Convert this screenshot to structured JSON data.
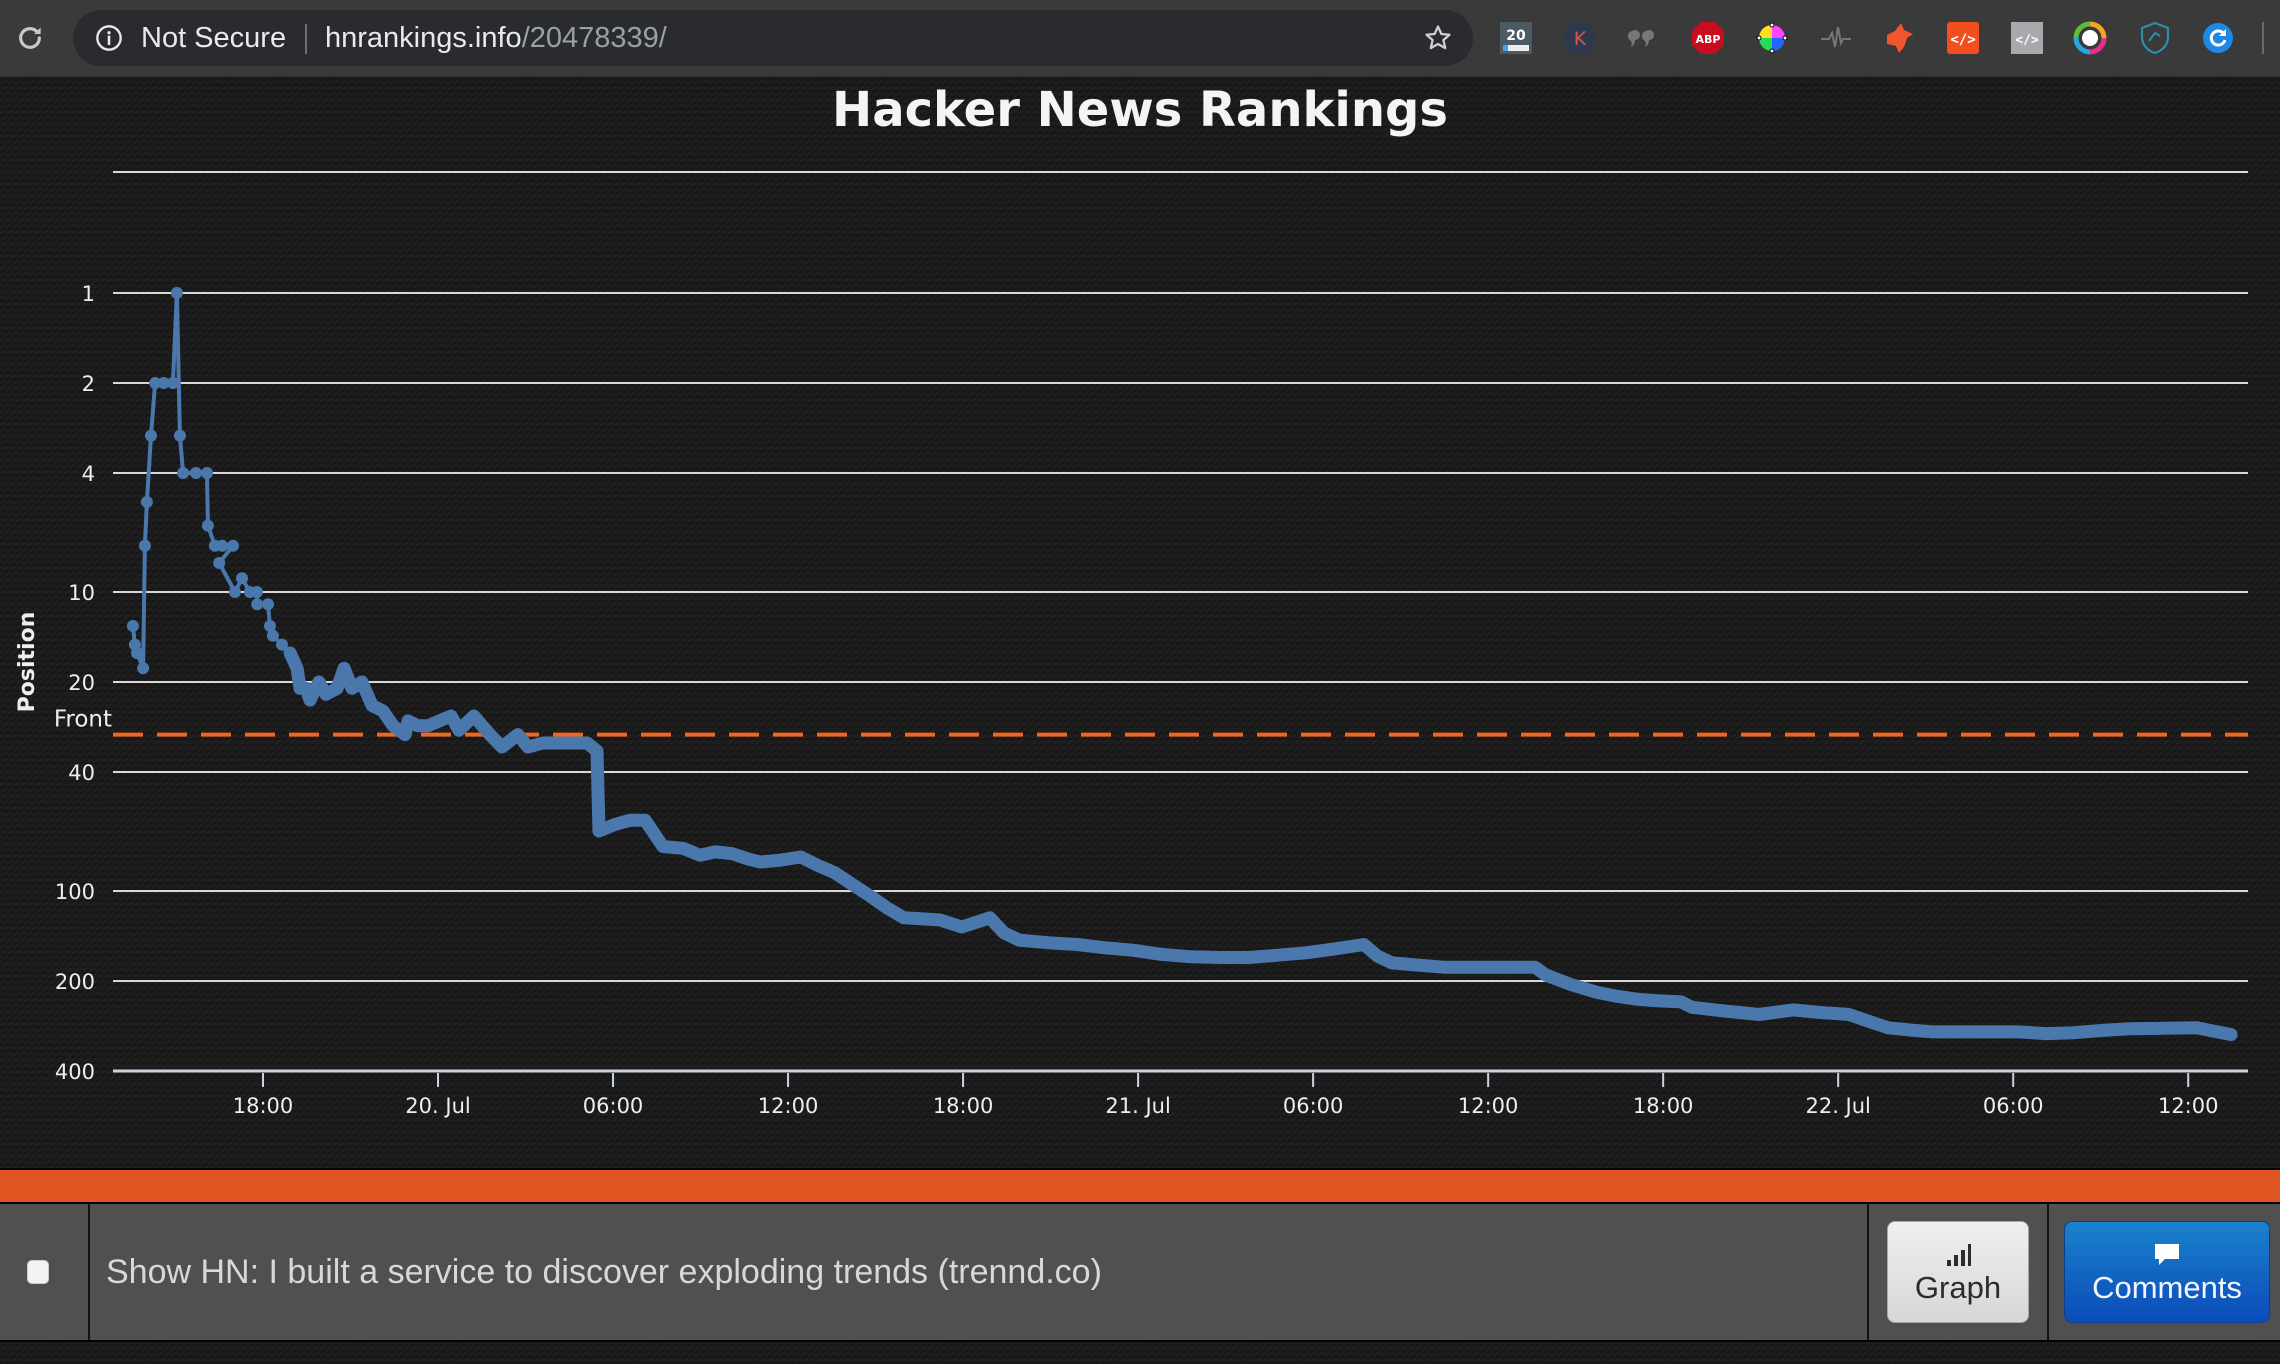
{
  "browser": {
    "security_label": "Not Secure",
    "url_host": "hnrankings.info",
    "url_path": "/20478339/",
    "extensions": [
      {
        "name": "tab-counter-extension-icon",
        "badge": "20"
      },
      {
        "name": "k-extension-icon",
        "badge": "K"
      },
      {
        "name": "quotes-extension-icon",
        "badge": ""
      },
      {
        "name": "adblock-plus-extension-icon",
        "badge": "ABP"
      },
      {
        "name": "color-picker-extension-icon",
        "badge": ""
      },
      {
        "name": "pulse-extension-icon",
        "badge": ""
      },
      {
        "name": "fox-extension-icon",
        "badge": ""
      },
      {
        "name": "code-red-extension-icon",
        "badge": ""
      },
      {
        "name": "code-gray-extension-icon",
        "badge": ""
      },
      {
        "name": "color-ring-extension-icon",
        "badge": ""
      },
      {
        "name": "shield-extension-icon",
        "badge": ""
      },
      {
        "name": "refresh-blue-extension-icon",
        "badge": ""
      }
    ]
  },
  "chart_data": {
    "type": "line",
    "title": "Hacker News Rankings",
    "xlabel": "",
    "ylabel": "Position",
    "y_scale": "log2-reversed",
    "ylim": [
      1,
      400
    ],
    "y_ticks": [
      1,
      2,
      4,
      10,
      20,
      40,
      100,
      200,
      400
    ],
    "x_unit": "hours since 19 Jul 00:00",
    "xlim": [
      13.0,
      87.0
    ],
    "x_ticks": [
      {
        "t": 18,
        "label": "18:00"
      },
      {
        "t": 24,
        "label": "20. Jul"
      },
      {
        "t": 30,
        "label": "06:00"
      },
      {
        "t": 36,
        "label": "12:00"
      },
      {
        "t": 42,
        "label": "18:00"
      },
      {
        "t": 48,
        "label": "21. Jul"
      },
      {
        "t": 54,
        "label": "06:00"
      },
      {
        "t": 60,
        "label": "12:00"
      },
      {
        "t": 66,
        "label": "18:00"
      },
      {
        "t": 72,
        "label": "22. Jul"
      },
      {
        "t": 78,
        "label": "06:00"
      },
      {
        "t": 84,
        "label": "12:00"
      }
    ],
    "grid": true,
    "reference_line": {
      "label": "Front",
      "value": 30,
      "color": "#f26522"
    },
    "series": [
      {
        "name": "Position",
        "color": "#4a78ad",
        "points": [
          [
            13.54,
            13
          ],
          [
            13.61,
            15
          ],
          [
            13.68,
            16
          ],
          [
            13.89,
            18
          ],
          [
            13.95,
            7
          ],
          [
            14.02,
            5
          ],
          [
            14.16,
            3
          ],
          [
            14.3,
            2
          ],
          [
            14.6,
            2
          ],
          [
            14.91,
            2
          ],
          [
            15.05,
            1
          ],
          [
            15.15,
            3
          ],
          [
            15.26,
            4
          ],
          [
            15.7,
            4
          ],
          [
            16.08,
            4
          ],
          [
            16.11,
            6
          ],
          [
            16.35,
            7
          ],
          [
            16.6,
            7
          ],
          [
            16.97,
            7
          ],
          [
            16.5,
            8
          ],
          [
            17.04,
            10
          ],
          [
            17.28,
            9
          ],
          [
            17.55,
            10
          ],
          [
            17.79,
            10
          ],
          [
            17.8,
            11
          ],
          [
            18.17,
            11
          ],
          [
            18.24,
            13
          ],
          [
            18.34,
            14
          ],
          [
            18.65,
            15
          ],
          [
            18.93,
            16
          ],
          [
            19.17,
            18
          ],
          [
            19.27,
            21
          ],
          [
            19.47,
            21
          ],
          [
            19.61,
            23
          ],
          [
            19.92,
            20
          ],
          [
            20.16,
            22
          ],
          [
            20.54,
            21
          ],
          [
            20.78,
            18
          ],
          [
            21.05,
            21
          ],
          [
            21.39,
            20
          ],
          [
            21.74,
            24
          ],
          [
            22.11,
            25
          ],
          [
            22.46,
            28
          ],
          [
            22.87,
            30
          ],
          [
            22.97,
            27
          ],
          [
            23.3,
            28
          ],
          [
            23.66,
            28
          ],
          [
            24.05,
            27
          ],
          [
            24.45,
            26
          ],
          [
            24.72,
            29
          ],
          [
            25.23,
            26
          ],
          [
            25.78,
            30
          ],
          [
            26.19,
            33
          ],
          [
            26.74,
            30
          ],
          [
            27.08,
            33
          ],
          [
            27.6,
            32
          ],
          [
            28.04,
            32
          ],
          [
            28.56,
            32
          ],
          [
            29.11,
            32
          ],
          [
            29.45,
            34
          ],
          [
            29.52,
            63
          ],
          [
            30.05,
            60
          ],
          [
            30.58,
            58
          ],
          [
            31.1,
            58
          ],
          [
            31.71,
            71
          ],
          [
            32.4,
            72
          ],
          [
            32.98,
            76
          ],
          [
            33.5,
            74
          ],
          [
            34.08,
            75
          ],
          [
            34.6,
            78
          ],
          [
            35.04,
            80
          ],
          [
            35.7,
            79
          ],
          [
            36.44,
            77
          ],
          [
            37.0,
            82
          ],
          [
            37.61,
            87
          ],
          [
            38.2,
            95
          ],
          [
            38.81,
            104
          ],
          [
            39.4,
            114
          ],
          [
            39.97,
            123
          ],
          [
            40.6,
            124
          ],
          [
            41.21,
            125
          ],
          [
            41.96,
            132
          ],
          [
            42.92,
            123
          ],
          [
            43.4,
            138
          ],
          [
            43.92,
            146
          ],
          [
            44.9,
            149
          ],
          [
            45.91,
            151
          ],
          [
            46.9,
            155
          ],
          [
            47.86,
            158
          ],
          [
            48.8,
            163
          ],
          [
            49.81,
            166
          ],
          [
            50.8,
            167
          ],
          [
            51.8,
            167
          ],
          [
            52.8,
            164
          ],
          [
            53.76,
            161
          ],
          [
            54.8,
            156
          ],
          [
            55.74,
            151
          ],
          [
            56.2,
            165
          ],
          [
            56.7,
            174
          ],
          [
            57.6,
            177
          ],
          [
            58.52,
            180
          ],
          [
            60.0,
            180
          ],
          [
            61.61,
            180
          ],
          [
            61.98,
            191
          ],
          [
            62.8,
            205
          ],
          [
            63.7,
            218
          ],
          [
            64.4,
            225
          ],
          [
            65.07,
            230
          ],
          [
            65.8,
            233
          ],
          [
            66.61,
            235
          ],
          [
            66.99,
            245
          ],
          [
            68.1,
            252
          ],
          [
            69.29,
            259
          ],
          [
            70.45,
            250
          ],
          [
            71.4,
            255
          ],
          [
            72.37,
            259
          ],
          [
            73.0,
            272
          ],
          [
            73.71,
            287
          ],
          [
            74.5,
            292
          ],
          [
            75.25,
            296
          ],
          [
            76.7,
            296
          ],
          [
            78.17,
            296
          ],
          [
            79.13,
            300
          ],
          [
            80.08,
            298
          ],
          [
            81.0,
            293
          ],
          [
            82.0,
            289
          ],
          [
            83.1,
            288
          ],
          [
            84.3,
            287
          ],
          [
            84.9,
            295
          ],
          [
            85.47,
            302
          ]
        ]
      }
    ]
  },
  "story": {
    "title": "Show HN: I built a service to discover exploding trends (trennd.co)",
    "graph_button": "Graph",
    "comments_button": "Comments"
  },
  "colors": {
    "accent_orange": "#df5622",
    "line_blue": "#4a78ad",
    "comments_blue": "#0d5fc4"
  }
}
